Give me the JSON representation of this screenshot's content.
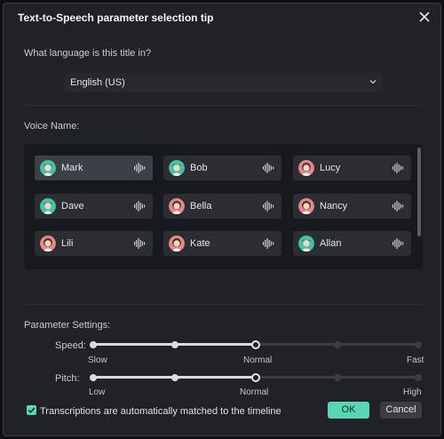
{
  "dialog": {
    "title": "Text-to-Speech parameter selection tip",
    "close_icon": "close-icon"
  },
  "language": {
    "question": "What language is this title in?",
    "selected": "English (US)"
  },
  "voices": {
    "label": "Voice Name:",
    "items": [
      {
        "name": "Mark",
        "gender": "male",
        "selected": true
      },
      {
        "name": "Bob",
        "gender": "male",
        "selected": false
      },
      {
        "name": "Lucy",
        "gender": "female",
        "selected": false
      },
      {
        "name": "Dave",
        "gender": "male",
        "selected": false
      },
      {
        "name": "Bella",
        "gender": "female",
        "selected": false
      },
      {
        "name": "Nancy",
        "gender": "female",
        "selected": false
      },
      {
        "name": "Lili",
        "gender": "female",
        "selected": false
      },
      {
        "name": "Kate",
        "gender": "female",
        "selected": false
      },
      {
        "name": "Allan",
        "gender": "male",
        "selected": false
      }
    ]
  },
  "parameters": {
    "label": "Parameter Settings:",
    "speed": {
      "label": "Speed:",
      "min_label": "Slow",
      "mid_label": "Normal",
      "max_label": "Fast",
      "steps": 5,
      "value_index": 2
    },
    "pitch": {
      "label": "Pitch:",
      "min_label": "Low",
      "mid_label": "Normal",
      "max_label": "High",
      "steps": 5,
      "value_index": 2
    }
  },
  "footer": {
    "auto_match_label": "Transcriptions are automatically matched to the timeline",
    "auto_match_checked": true,
    "ok_label": "OK",
    "cancel_label": "Cancel"
  },
  "colors": {
    "accent": "#59d6b3",
    "male_avatar": "#49c2a4",
    "female_avatar": "#e58a8a"
  }
}
